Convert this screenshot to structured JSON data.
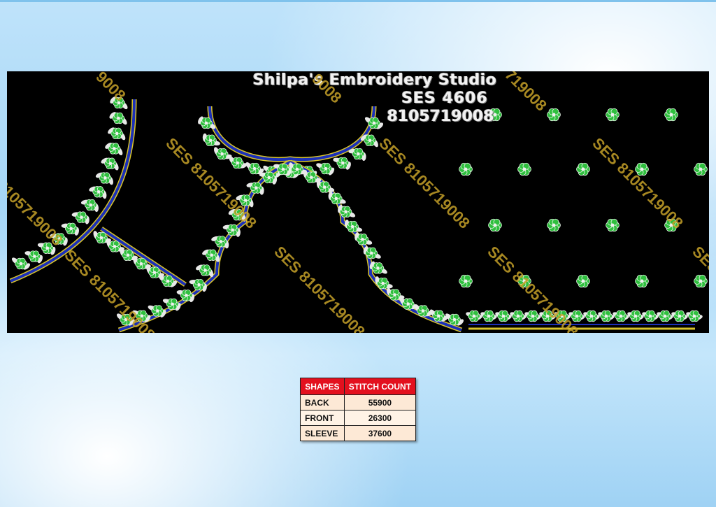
{
  "studio": {
    "name": "Shilpa's Embroidery Studio",
    "design_code": "SES  4606",
    "phone": "8105719008"
  },
  "watermark": {
    "text": "SES 8105719008",
    "partial_texts": [
      "9008",
      "8105719008",
      "719008",
      "SES 8"
    ]
  },
  "colors": {
    "panel_background": "#000000",
    "flower": "#2fbf3e",
    "leaf": "#e8e8e8",
    "outline_blue": "#1b2fb8",
    "outline_gold": "#d9c52a",
    "watermark": "#c4a028",
    "table_header": "#e3101e"
  },
  "table": {
    "headers": [
      "SHAPES",
      "STITCH COUNT"
    ],
    "rows": [
      {
        "shape": "BACK",
        "count": "55900"
      },
      {
        "shape": "FRONT",
        "count": "26300"
      },
      {
        "shape": "SLEEVE",
        "count": "37600"
      }
    ]
  }
}
